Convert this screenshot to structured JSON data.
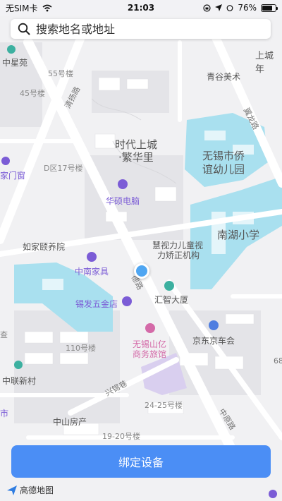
{
  "status_bar": {
    "carrier": "无SIM卡",
    "time": "21:03",
    "battery": "76%",
    "battery_level": 0.76
  },
  "search": {
    "placeholder": "搜索地名或地址"
  },
  "map": {
    "labels": {
      "zhongxingyuan": "中星苑",
      "no55": "55号楼",
      "no45": "45号楼",
      "qingguyanshu": "青谷美术",
      "wuxi_top_right": "上城年",
      "shidai1": "时代上城",
      "shidai2": "·繁华里",
      "kindergarten1": "无锡市侨",
      "kindergarten2": "谊幼儿园",
      "d17": "D区17号楼",
      "jiamenchuang": "家门窗",
      "huashuo": "华硕电脑",
      "nanhu": "南湖小学",
      "rujia": "如家颐养院",
      "huishi1": "慧视力儿童视",
      "huishi2": "力矫正机构",
      "zhongnan": "中南家具",
      "huizhi": "汇智大厦",
      "xifa": "锡发五金店",
      "jingdong": "京东京车会",
      "shanyi1": "无锡山亿",
      "shanyi2": "商务旅馆",
      "no110": "110号楼",
      "zhonglian": "中联新村",
      "xingxi": "兴锡巷",
      "no24_25": "24-25号楼",
      "zhongshan": "中山房产",
      "no19_20": "19-20号楼",
      "zhongyuan": "中原路",
      "qing_road": "清扬路",
      "road_ne": "翼龙路",
      "road_mid": "德路",
      "six8": "68",
      "left_shi": "市",
      "left_cha": "查"
    }
  },
  "bind_button": {
    "label": "绑定设备"
  },
  "logo": {
    "text": "高德地图"
  }
}
